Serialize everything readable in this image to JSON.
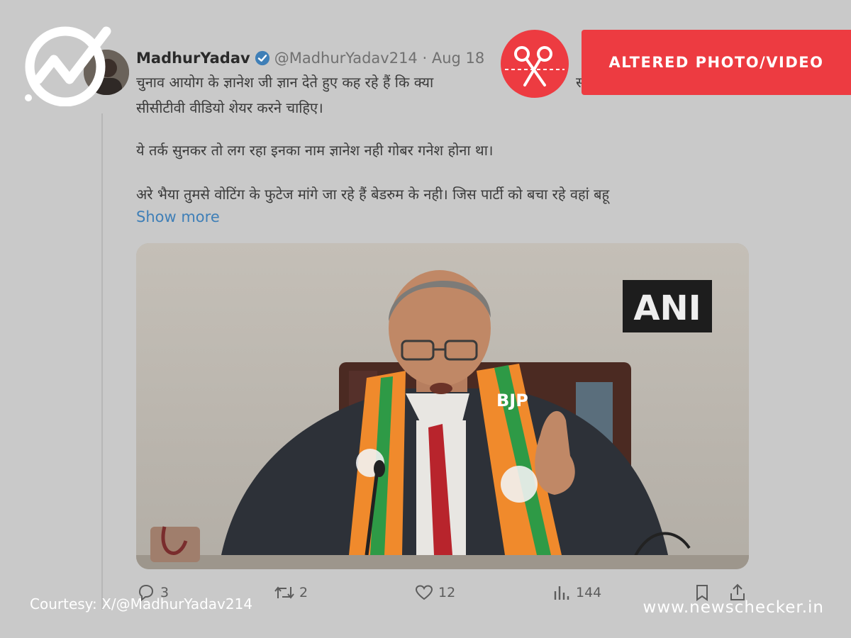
{
  "tweet": {
    "author_name": "MadhurYadav",
    "handle": "@MadhurYadav214",
    "separator": "·",
    "date": "Aug 18",
    "lines": [
      "चुनाव आयोग के ज्ञानेश जी ज्ञान देते हुए कह रहे हैं कि क्या",
      "सीसीटीवी वीडियो शेयर करने चाहिए।",
      "ये तर्क सुनकर तो लग रहा इनका नाम ज्ञानेश नही गोबर गनेश होना था।",
      "अरे भैया तुमसे वोटिंग के फुटेज मांगे जा रहे हैं बेडरुम के नही। जिस पार्टी को बचा रहे वहां बहू"
    ],
    "partial_line_tail": "सी",
    "show_more": "Show more",
    "media": {
      "watermark": "ANI",
      "scarf_text": "BJP"
    },
    "actions": {
      "replies": "3",
      "retweets": "2",
      "likes": "12",
      "views": "144"
    }
  },
  "overlay": {
    "label": "ALTERED PHOTO/VIDEO",
    "courtesy": "Courtesy: X/@MadhurYadav214",
    "site": "www.newschecker.in",
    "accent_color": "#ed3b41",
    "link_color": "#3f7fb7"
  }
}
